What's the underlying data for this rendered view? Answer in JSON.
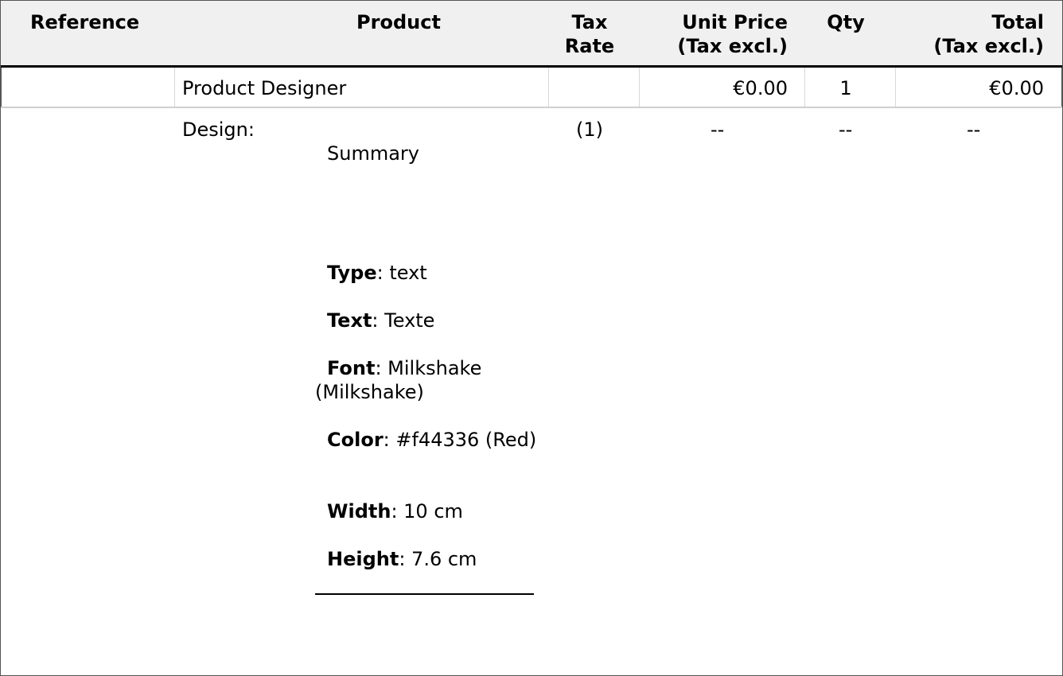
{
  "headers": {
    "reference": "Reference",
    "product": "Product",
    "tax_rate_1": "Tax",
    "tax_rate_2": "Rate",
    "unit_price_1": "Unit Price",
    "unit_price_2": "(Tax excl.)",
    "qty": "Qty",
    "total_1": "Total",
    "total_2": "(Tax excl.)"
  },
  "row1": {
    "product": "Product Designer",
    "unit_price": "€0.00",
    "qty": "1",
    "total": "€0.00"
  },
  "row2": {
    "label": "Design:",
    "summary": "Summary",
    "tax_rate": "(1)",
    "unit_price": "--",
    "qty": "--",
    "total": "--",
    "attributes": [
      {
        "key": "Type",
        "value": ": text"
      },
      {
        "key": "Text",
        "value": ": Texte"
      },
      {
        "key": "Font",
        "value": ": Milkshake (Milkshake)"
      },
      {
        "key": "Color",
        "value": ": #f44336 (Red)"
      },
      {
        "key": "Width",
        "value": ": 10 cm"
      },
      {
        "key": "Height",
        "value": ": 7.6 cm"
      }
    ]
  }
}
